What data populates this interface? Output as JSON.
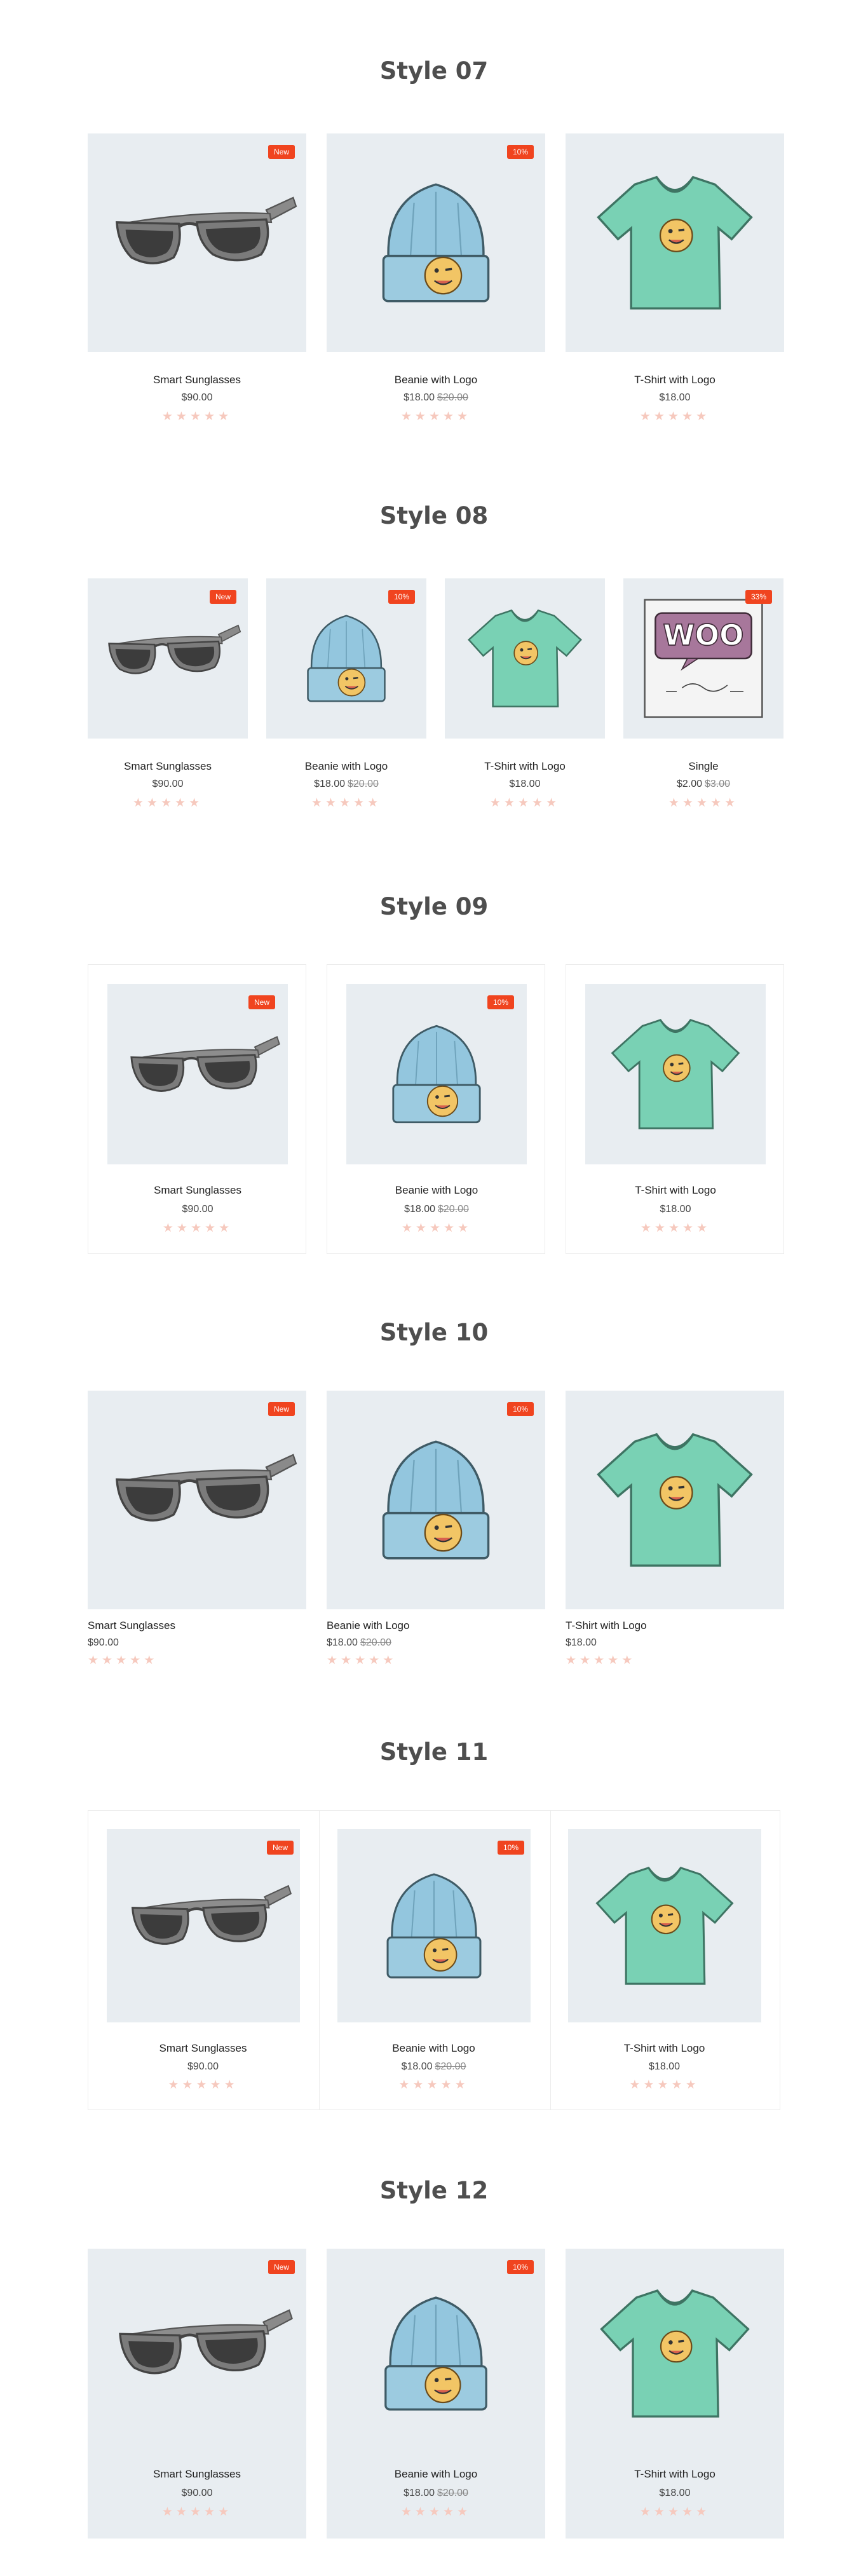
{
  "badge_color": "#f0441f",
  "image_bg": "#e8edf1",
  "star_color": "#f6c9be",
  "products": {
    "sunglasses": {
      "name": "Smart Sunglasses",
      "price": "$90.00",
      "old_price": "",
      "badge": "New",
      "icon": "sunglasses-icon"
    },
    "beanie": {
      "name": "Beanie with Logo",
      "price": "$18.00",
      "old_price": "$20.00",
      "badge": "10%",
      "icon": "beanie-icon"
    },
    "tshirt": {
      "name": "T-Shirt with Logo",
      "price": "$18.00",
      "old_price": "",
      "badge": "",
      "icon": "tshirt-icon"
    },
    "single": {
      "name": "Single",
      "price": "$2.00",
      "old_price": "$3.00",
      "badge": "33%",
      "icon": "woo-single-icon"
    }
  },
  "sections": {
    "s07": {
      "title": "Style 07"
    },
    "s08": {
      "title": "Style 08"
    },
    "s09": {
      "title": "Style 09"
    },
    "s10": {
      "title": "Style 10"
    },
    "s11": {
      "title": "Style 11"
    },
    "s12": {
      "title": "Style 12"
    }
  },
  "rating": {
    "stars": 5,
    "filled": 0,
    "star_glyph": "★"
  }
}
